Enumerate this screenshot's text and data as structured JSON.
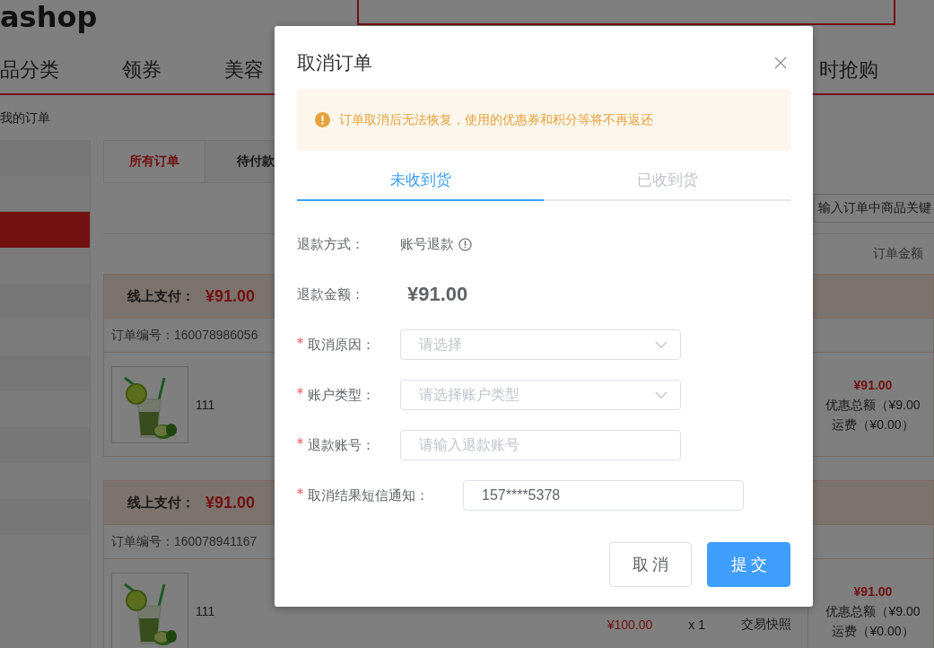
{
  "header": {
    "logo": "ashop"
  },
  "nav": {
    "items": [
      {
        "label": "品分类"
      },
      {
        "label": "领券"
      },
      {
        "label": "美容"
      },
      {
        "label": "时抢购"
      }
    ]
  },
  "breadcrumb": "我的订单",
  "sidebar": {
    "items": [
      {
        "selected": false
      },
      {
        "selected": true
      },
      {
        "selected": false
      },
      {
        "selected": false
      },
      {
        "selected": false
      },
      {
        "selected": false
      }
    ]
  },
  "order_tabs": [
    {
      "label": "所有订单",
      "selected": true
    },
    {
      "label": "待付款",
      "selected": false
    }
  ],
  "search": {
    "placeholder": "输入订单中商品关键"
  },
  "table_header": {
    "amount": "订单金额"
  },
  "orders": [
    {
      "payment_label": "线上支付：",
      "payment_amount": "¥91.00",
      "order_number": "订单编号：160078986056",
      "product_name": "111",
      "total": "¥91.00",
      "discount": "优惠总额（¥9.00",
      "shipping": "运费（¥0.00）"
    },
    {
      "payment_label": "线上支付：",
      "payment_amount": "¥91.00",
      "order_number": "订单编号：160078941167",
      "product_name": "111",
      "unit_price": "¥100.00",
      "quantity": "x 1",
      "snapshot": "交易快照",
      "total": "¥91.00",
      "discount": "优惠总额（¥9.00",
      "shipping": "运费（¥0.00）"
    }
  ],
  "dialog": {
    "title": "取消订单",
    "alert": "订单取消后无法恢复，使用的优惠券和积分等将不再返还",
    "tabs": [
      {
        "label": "未收到货",
        "selected": true
      },
      {
        "label": "已收到货",
        "selected": false
      }
    ],
    "fields": [
      {
        "kind": "text",
        "label": "退款方式：",
        "value": "账号退款",
        "required": false
      },
      {
        "kind": "amount",
        "label": "退款金额：",
        "value": "¥91.00",
        "required": false
      },
      {
        "kind": "select",
        "label": "取消原因：",
        "placeholder": "请选择",
        "required": true
      },
      {
        "kind": "select",
        "label": "账户类型：",
        "placeholder": "请选择账户类型",
        "required": true
      },
      {
        "kind": "input",
        "label": "退款账号：",
        "placeholder": "请输入退款账号",
        "required": true
      },
      {
        "kind": "input",
        "label": "取消结果短信通知：",
        "value": "157****5378",
        "required": true,
        "wide": true
      }
    ],
    "buttons": [
      {
        "kind": "default",
        "label": "取消"
      },
      {
        "kind": "primary",
        "label": "提交"
      }
    ]
  }
}
